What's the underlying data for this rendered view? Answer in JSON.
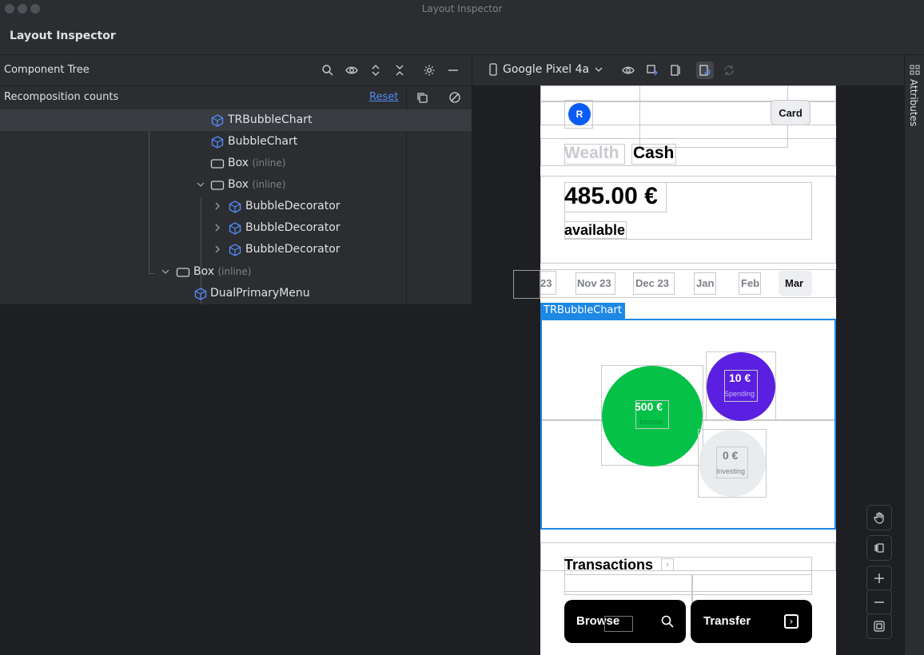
{
  "window": {
    "title": "Layout Inspector"
  },
  "tool": {
    "title": "Layout Inspector"
  },
  "component_tree": {
    "title": "Component Tree",
    "recomposition_label": "Recomposition counts",
    "reset_label": "Reset",
    "inline_suffix": "(inline)",
    "rows": [
      {
        "label": "TRBubbleChart",
        "icon": "compose-icon",
        "selected": true
      },
      {
        "label": "BubbleChart",
        "icon": "compose-icon"
      },
      {
        "label": "Box",
        "icon": "box-icon",
        "inline": true
      },
      {
        "label": "Box",
        "icon": "box-icon",
        "inline": true,
        "expanded": true
      },
      {
        "label": "BubbleDecorator",
        "icon": "compose-icon",
        "collapsed": true
      },
      {
        "label": "BubbleDecorator",
        "icon": "compose-icon",
        "collapsed": true
      },
      {
        "label": "BubbleDecorator",
        "icon": "compose-icon",
        "collapsed": true
      },
      {
        "label": "Box",
        "icon": "box-icon",
        "inline": true,
        "expanded": true
      },
      {
        "label": "DualPrimaryMenu",
        "icon": "compose-icon"
      }
    ]
  },
  "device": {
    "name": "Google Pixel 4a"
  },
  "attributes": {
    "label": "Attributes"
  },
  "screen": {
    "avatar_letter": "R",
    "card_label": "Card",
    "tab_wealth": "Wealth",
    "tab_cash": "Cash",
    "balance": "485.00 €",
    "balance_caption": "available",
    "months": [
      "23",
      "Nov 23",
      "Dec 23",
      "Jan",
      "Feb",
      "Mar"
    ],
    "selected_label": "TRBubbleChart",
    "bubbles": [
      {
        "amount": "500 €",
        "label": "Income",
        "color": "#05c148"
      },
      {
        "amount": "10 €",
        "label": "Spending",
        "color": "#5a1fe0"
      },
      {
        "amount": "0 €",
        "label": "Investing",
        "color": "#e9ecef"
      }
    ],
    "transactions_label": "Transactions",
    "menu_browse": "Browse",
    "menu_transfer": "Transfer"
  },
  "colors": {
    "accent": "#3574f0",
    "selection": "#1e88e5"
  }
}
